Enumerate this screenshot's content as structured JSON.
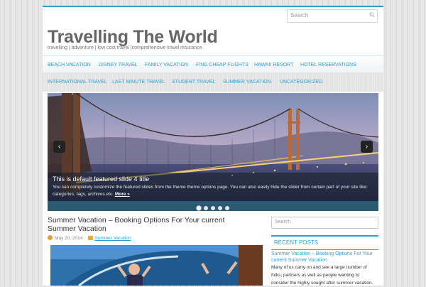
{
  "header": {
    "search_placeholder": "Search",
    "site_title": "Travelling The World",
    "site_description": "travelling | adventure | low cost travel |comprehensive travel insurance"
  },
  "nav_primary": [
    {
      "label": "BEACH VACATION"
    },
    {
      "label": "DISNEY TRAVEL"
    },
    {
      "label": "FAMILY VACATION"
    },
    {
      "label": "FIND CHEAP FLIGHTS"
    },
    {
      "label": "HAWAII RESORT"
    },
    {
      "label": "HOTEL RESERVATIONS"
    }
  ],
  "nav_secondary": [
    {
      "label": "INTERNATIONAL TRAVEL"
    },
    {
      "label": "LAST MINUTE TRAVEL"
    },
    {
      "label": "STUDENT TRAVEL"
    },
    {
      "label": "SUMMER VACATION"
    },
    {
      "label": "UNCATEGORIZED"
    }
  ],
  "slider": {
    "title": "This is default featured slide 4 title",
    "text": "You can completely customize the featured slides from the theme theme options page. You can also easily hide the slider from certain part of your site like: categories, tags, archives etc.",
    "more_label": "More »",
    "prev_icon": "‹",
    "next_icon": "›",
    "slide_count": 5,
    "active_slide": 1
  },
  "post": {
    "title": "Summer Vacation – Booking Options For Your current Summer Vacation",
    "date": "May 20, 2014",
    "category": "Summer Vacation"
  },
  "sidebar": {
    "search_placeholder": "Search",
    "recent_heading": "RECENT POSTS",
    "recent_link": "Summer Vacation – Booking Options For Your current Summer Vacation",
    "recent_excerpt": "Many of us carry on and see a large number of folks, partners as well as people wanting to consider the highly sought after summer vacation."
  },
  "colors": {
    "accent": "#2a9fd6",
    "title": "#666666"
  }
}
